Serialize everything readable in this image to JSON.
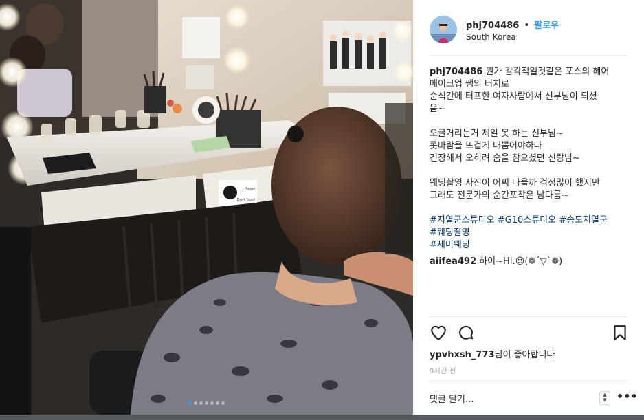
{
  "photo": {
    "carousel": {
      "count": 7,
      "active": 0
    },
    "sign_text": [
      "Please",
      "Don't Touch"
    ]
  },
  "header": {
    "username": "phj704486",
    "separator": "•",
    "follow_label": "팔로우",
    "location": "South Korea"
  },
  "caption": {
    "username": "phj704486",
    "lines": [
      "뭔가 감각적일것같은 포스의 헤어",
      "메이크업 쌤의 터치로",
      "순식간에 터프한 여자사람에서 신부님이 되셨",
      "음~",
      "",
      "오글거리는거 제일 못 하는 신부님~",
      "콧바람을 뜨겁게 내뿜어야하나",
      "긴장해서 오히려 숨을 참으셨던 신랑님~",
      "",
      "웨딩촬영 사진이 어찌 나올까 걱정많이 했지만",
      "그래도 전문가의 순간포착은 남다름~"
    ],
    "first_line": "뭔가 감각적일것같은 포스의 헤어",
    "hashtag_lines": [
      "#지열군스튜디오 #G10스튜디오 #송도지열군",
      "#웨딩촬영",
      "#세미웨딩"
    ]
  },
  "comment": {
    "username": "aiifea492",
    "text": "하이~HI.☺(❁´▽`❁)"
  },
  "actions": {
    "like_icon": "heart-icon",
    "comment_icon": "comment-icon",
    "save_icon": "bookmark-icon"
  },
  "likes": {
    "username": "ypvhxsh_773",
    "suffix": "님이 좋아합니다"
  },
  "timestamp": "9시간 전",
  "comment_input": {
    "placeholder": "댓글 달기...",
    "more_label": "•••"
  }
}
